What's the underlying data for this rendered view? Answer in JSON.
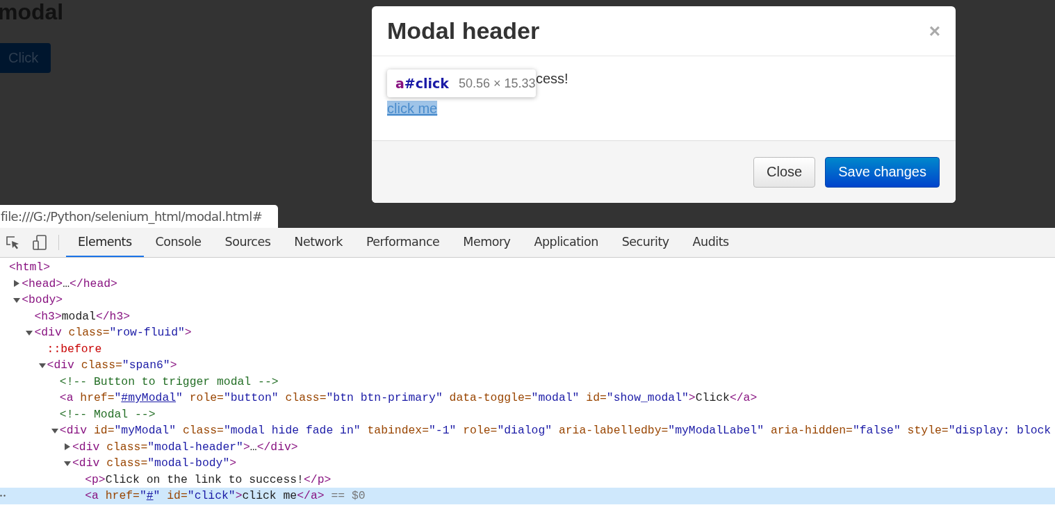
{
  "page": {
    "heading": "modal",
    "button": "Click"
  },
  "modal": {
    "title": "Modal header",
    "close": "×",
    "paragraph_visible": "cess!",
    "link": "click me",
    "link_highlighted": true,
    "buttons": [
      {
        "label": "Close",
        "kind": "default"
      },
      {
        "label": "Save changes",
        "kind": "primary"
      }
    ]
  },
  "inspect_tooltip": {
    "tag": "a",
    "id": "#click",
    "size": "50.56 × 15.33"
  },
  "status_url": "file:///G:/Python/selenium_html/modal.html#",
  "devtools": {
    "tabs": [
      {
        "label": "Elements",
        "selected": true
      },
      {
        "label": "Console",
        "selected": false
      },
      {
        "label": "Sources",
        "selected": false
      },
      {
        "label": "Network",
        "selected": false
      },
      {
        "label": "Performance",
        "selected": false
      },
      {
        "label": "Memory",
        "selected": false
      },
      {
        "label": "Application",
        "selected": false
      },
      {
        "label": "Security",
        "selected": false
      },
      {
        "label": "Audits",
        "selected": false
      }
    ],
    "dom_tree": [
      {
        "selected": false,
        "tokens": [
          {
            "kind": "tag",
            "text": "<html>"
          }
        ],
        "children": [
          {
            "selected": false,
            "expanded": false,
            "tokens": [
              {
                "kind": "tag",
                "text": "<head>"
              },
              {
                "kind": "text",
                "text": "…"
              },
              {
                "kind": "tag",
                "text": "</head>"
              }
            ]
          },
          {
            "selected": false,
            "expanded": true,
            "tokens": [
              {
                "kind": "tag",
                "text": "<body>"
              }
            ],
            "children": [
              {
                "selected": false,
                "tokens": [
                  {
                    "kind": "tag",
                    "text": "<h3>"
                  },
                  {
                    "kind": "text",
                    "text": "modal"
                  },
                  {
                    "kind": "tag",
                    "text": "</h3>"
                  }
                ]
              },
              {
                "selected": false,
                "expanded": true,
                "tokens": [
                  {
                    "kind": "tag",
                    "text": "<div"
                  },
                  {
                    "kind": "attr",
                    "text": " class="
                  },
                  {
                    "kind": "val",
                    "text": "\"row-fluid\""
                  },
                  {
                    "kind": "tag",
                    "text": ">"
                  }
                ],
                "children": [
                  {
                    "selected": false,
                    "tokens": [
                      {
                        "kind": "pseudo",
                        "text": "::before"
                      }
                    ]
                  },
                  {
                    "selected": false,
                    "expanded": true,
                    "tokens": [
                      {
                        "kind": "tag",
                        "text": "<div"
                      },
                      {
                        "kind": "attr",
                        "text": " class="
                      },
                      {
                        "kind": "val",
                        "text": "\"span6\""
                      },
                      {
                        "kind": "tag",
                        "text": ">"
                      }
                    ],
                    "children": [
                      {
                        "selected": false,
                        "tokens": [
                          {
                            "kind": "comment",
                            "text": "<!-- Button to trigger modal -->"
                          }
                        ]
                      },
                      {
                        "selected": false,
                        "tokens": [
                          {
                            "kind": "tag",
                            "text": "<a"
                          },
                          {
                            "kind": "attr",
                            "text": " href="
                          },
                          {
                            "kind": "val",
                            "text": "\""
                          },
                          {
                            "kind": "link",
                            "text": "#myModal"
                          },
                          {
                            "kind": "val",
                            "text": "\""
                          },
                          {
                            "kind": "attr",
                            "text": " role="
                          },
                          {
                            "kind": "val",
                            "text": "\"button\""
                          },
                          {
                            "kind": "attr",
                            "text": " class="
                          },
                          {
                            "kind": "val",
                            "text": "\"btn btn-primary\""
                          },
                          {
                            "kind": "attr",
                            "text": " data-toggle="
                          },
                          {
                            "kind": "val",
                            "text": "\"modal\""
                          },
                          {
                            "kind": "attr",
                            "text": " id="
                          },
                          {
                            "kind": "val",
                            "text": "\"show_modal\""
                          },
                          {
                            "kind": "tag",
                            "text": ">"
                          },
                          {
                            "kind": "text",
                            "text": "Click"
                          },
                          {
                            "kind": "tag",
                            "text": "</a>"
                          }
                        ]
                      },
                      {
                        "selected": false,
                        "tokens": [
                          {
                            "kind": "comment",
                            "text": "<!-- Modal -->"
                          }
                        ]
                      },
                      {
                        "selected": false,
                        "expanded": true,
                        "tokens": [
                          {
                            "kind": "tag",
                            "text": "<div"
                          },
                          {
                            "kind": "attr",
                            "text": " id="
                          },
                          {
                            "kind": "val",
                            "text": "\"myModal\""
                          },
                          {
                            "kind": "attr",
                            "text": " class="
                          },
                          {
                            "kind": "val",
                            "text": "\"modal hide fade in\""
                          },
                          {
                            "kind": "attr",
                            "text": " tabindex="
                          },
                          {
                            "kind": "val",
                            "text": "\"-1\""
                          },
                          {
                            "kind": "attr",
                            "text": " role="
                          },
                          {
                            "kind": "val",
                            "text": "\"dialog\""
                          },
                          {
                            "kind": "attr",
                            "text": " aria-labelledby="
                          },
                          {
                            "kind": "val",
                            "text": "\"myModalLabel\""
                          },
                          {
                            "kind": "attr",
                            "text": " aria-hidden="
                          },
                          {
                            "kind": "val",
                            "text": "\"false\""
                          },
                          {
                            "kind": "attr",
                            "text": " style="
                          },
                          {
                            "kind": "val",
                            "text": "\"display: block"
                          }
                        ],
                        "children": [
                          {
                            "selected": false,
                            "expanded": false,
                            "tokens": [
                              {
                                "kind": "tag",
                                "text": "<div"
                              },
                              {
                                "kind": "attr",
                                "text": " class="
                              },
                              {
                                "kind": "val",
                                "text": "\"modal-header\""
                              },
                              {
                                "kind": "tag",
                                "text": ">"
                              },
                              {
                                "kind": "text",
                                "text": "…"
                              },
                              {
                                "kind": "tag",
                                "text": "</div>"
                              }
                            ]
                          },
                          {
                            "selected": false,
                            "expanded": true,
                            "tokens": [
                              {
                                "kind": "tag",
                                "text": "<div"
                              },
                              {
                                "kind": "attr",
                                "text": " class="
                              },
                              {
                                "kind": "val",
                                "text": "\"modal-body\""
                              },
                              {
                                "kind": "tag",
                                "text": ">"
                              }
                            ],
                            "children": [
                              {
                                "selected": false,
                                "tokens": [
                                  {
                                    "kind": "tag",
                                    "text": "<p>"
                                  },
                                  {
                                    "kind": "text",
                                    "text": "Click on the link to success!"
                                  },
                                  {
                                    "kind": "tag",
                                    "text": "</p>"
                                  }
                                ]
                              },
                              {
                                "selected": true,
                                "tokens": [
                                  {
                                    "kind": "tag",
                                    "text": "<a"
                                  },
                                  {
                                    "kind": "attr",
                                    "text": " href="
                                  },
                                  {
                                    "kind": "val",
                                    "text": "\""
                                  },
                                  {
                                    "kind": "link",
                                    "text": "#"
                                  },
                                  {
                                    "kind": "val",
                                    "text": "\""
                                  },
                                  {
                                    "kind": "attr",
                                    "text": " id="
                                  },
                                  {
                                    "kind": "val",
                                    "text": "\"click\""
                                  },
                                  {
                                    "kind": "tag",
                                    "text": ">"
                                  },
                                  {
                                    "kind": "text",
                                    "text": "click me"
                                  },
                                  {
                                    "kind": "tag",
                                    "text": "</a>"
                                  },
                                  {
                                    "kind": "ref",
                                    "text": " == $0"
                                  }
                                ]
                              }
                            ]
                          }
                        ]
                      }
                    ]
                  }
                ]
              }
            ]
          }
        ]
      }
    ]
  }
}
